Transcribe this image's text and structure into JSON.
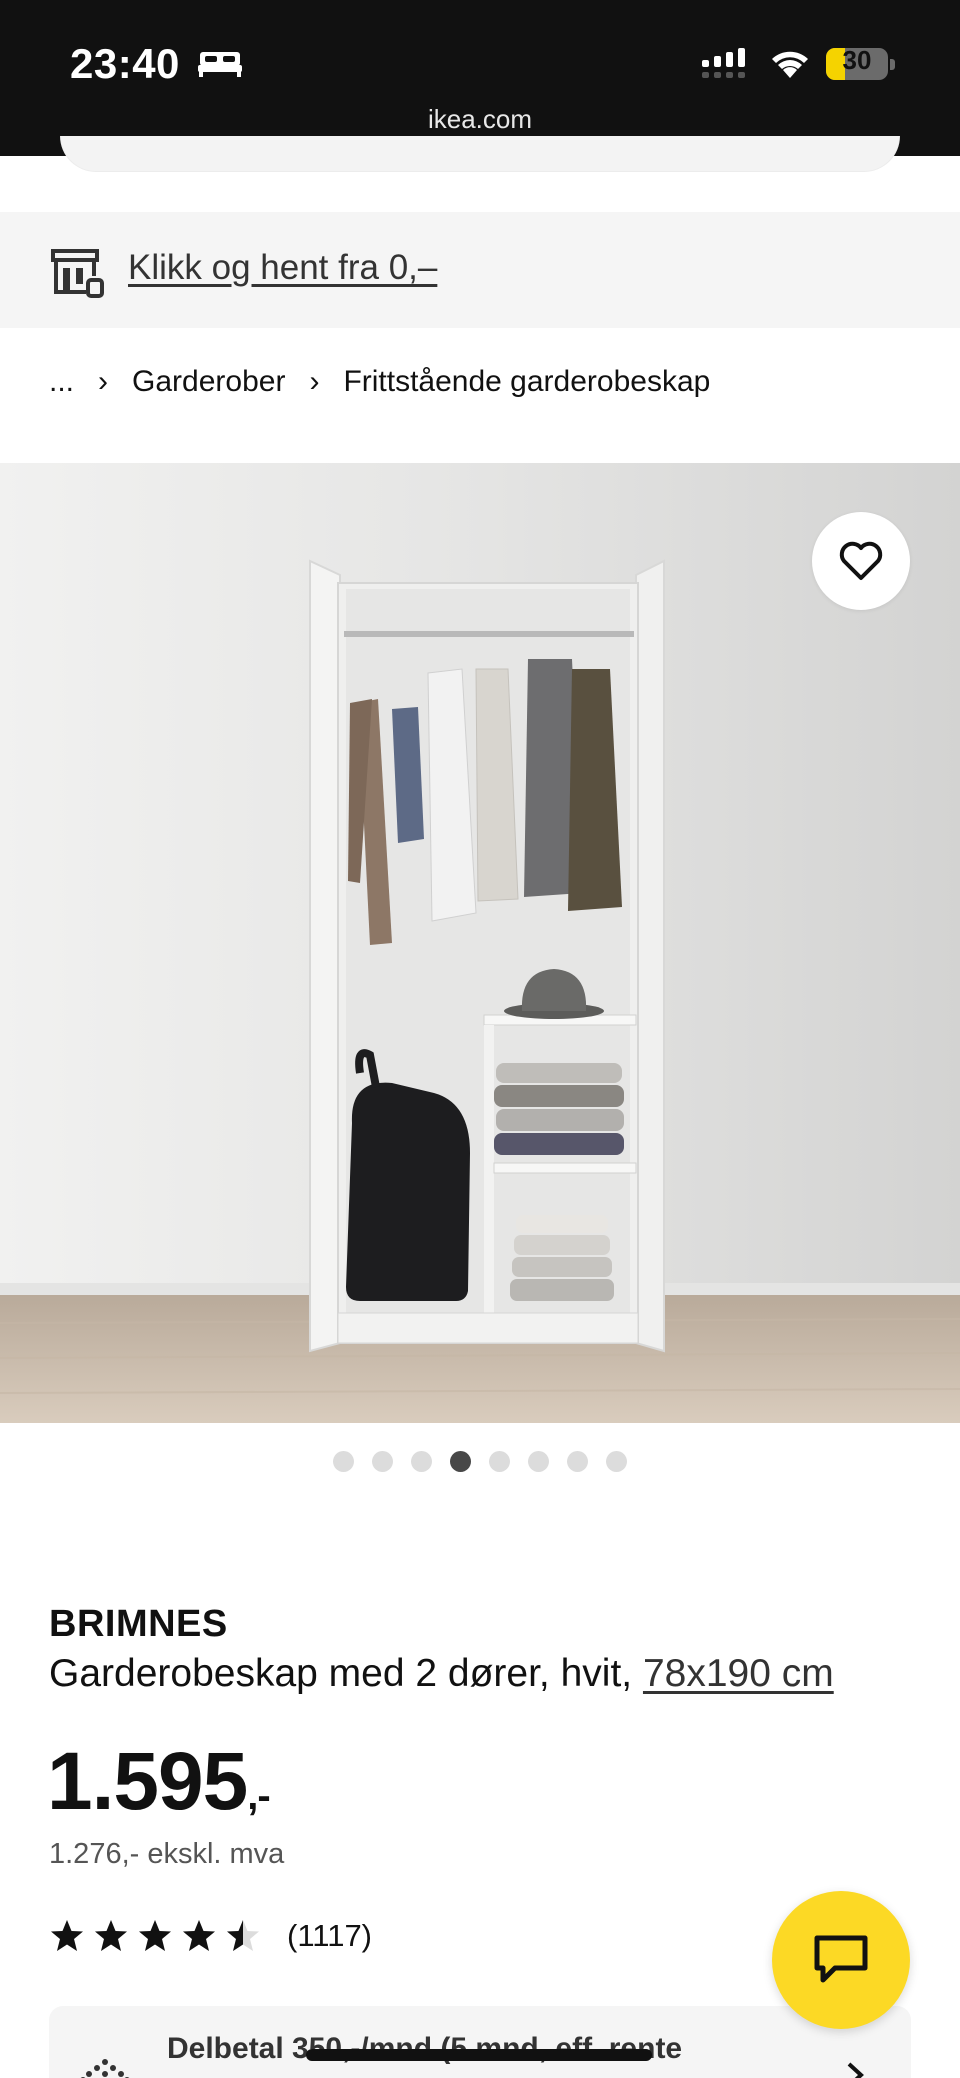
{
  "status_bar": {
    "time": "23:40",
    "battery": "30",
    "battery_fraction": 0.3,
    "url": "ikea.com",
    "icons": [
      "bed-icon",
      "cellular-signal-icon",
      "wifi-icon",
      "battery-icon"
    ]
  },
  "banner": {
    "icon": "store-pickup-icon",
    "label": "Klikk og hent fra 0,–"
  },
  "breadcrumb": {
    "items": [
      "...",
      "Garderober",
      "Frittstående garderobeskap"
    ],
    "separator": "›"
  },
  "product": {
    "image_icon": "wardrobe-product-image",
    "favorite_icon": "heart-icon",
    "carousel": {
      "total": 8,
      "active_index": 3
    },
    "brand": "BRIMNES",
    "description": "Garderobeskap med 2 dører, hvit, ",
    "size": "78x190 cm",
    "price": "1.595",
    "price_suffix": ",-",
    "price_ex_vat": "1.276,- ekskl. mva",
    "rating": 4.5,
    "reviews": "(1117)"
  },
  "installment": {
    "icon": "payment-icon",
    "text": "Delbetal 350,-/mnd (5 mnd, eff. rente"
  },
  "chat": {
    "icon": "chat-icon"
  },
  "colors": {
    "accent_yellow": "#fcd925",
    "status_bar": "#111111",
    "banner_bg": "#f5f5f5"
  }
}
